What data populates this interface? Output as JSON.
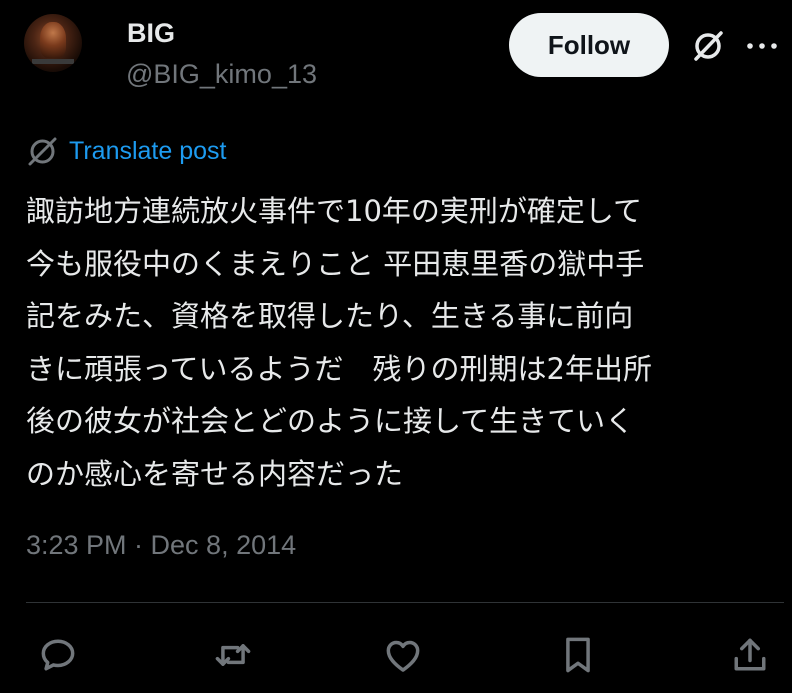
{
  "author": {
    "display_name": "BIG",
    "handle": "@BIG_kimo_13"
  },
  "header": {
    "follow_label": "Follow"
  },
  "translate": {
    "label": "Translate post"
  },
  "post": {
    "text_lines": [
      "諏訪地方連続放火事件で10年の実刑が確定して",
      "今も服役中のくまえりこと 平田恵里香の獄中手",
      "記をみた、資格を取得したり、生きる事に前向",
      "きに頑張っているようだ　残りの刑期は2年出所",
      "後の彼女が社会とどのように接して生きていく",
      "のか感心を寄せる内容だった"
    ],
    "timestamp": "3:23 PM · Dec 8, 2014"
  },
  "icons": {
    "grok": "grok-icon",
    "more": "more-icon",
    "translate": "translate-icon",
    "reply": "reply-icon",
    "repost": "repost-icon",
    "like": "like-icon",
    "bookmark": "bookmark-icon",
    "share": "share-icon"
  },
  "colors": {
    "background": "#000000",
    "text": "#e7e9ea",
    "secondary_text": "#71767b",
    "link": "#1d9bf0",
    "follow_button_bg": "#eff3f4",
    "divider": "#2f3336"
  }
}
